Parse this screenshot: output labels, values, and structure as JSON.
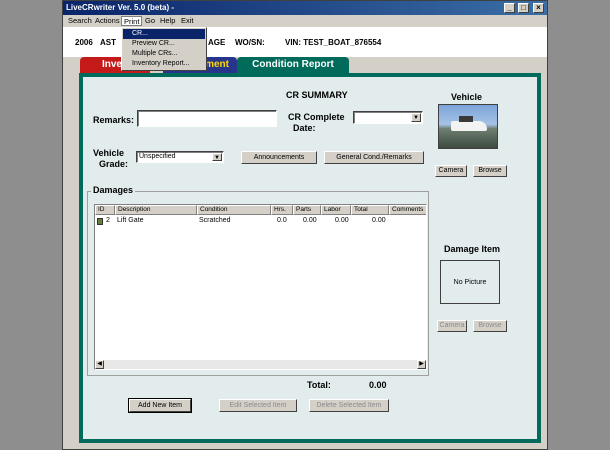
{
  "window": {
    "title": "LiveCRwriter Ver. 5.0 (beta) -"
  },
  "menu": {
    "items": [
      "Search",
      "Actions",
      "Print",
      "Go",
      "Help",
      "Exit"
    ]
  },
  "print_menu": {
    "items": [
      "CR...",
      "Preview CR...",
      "Multiple CRs...",
      "Inventory Report..."
    ]
  },
  "info": {
    "year": "2006",
    "make": "AST",
    "partial": "AGE",
    "wo_label": "WO/SN:",
    "vin": "VIN: TEST_BOAT_876554"
  },
  "tabs": {
    "inventory": "Inven",
    "equipment": "ment",
    "condition": "Condition Report"
  },
  "summary": {
    "title": "CR SUMMARY",
    "remarks_label": "Remarks:",
    "remarks_value": "",
    "complete_date_label_1": "CR Complete",
    "complete_date_label_2": "Date:",
    "grade_label_1": "Vehicle",
    "grade_label_2": "Grade:",
    "grade_value": "Unspecified",
    "announcements_btn": "Announcements",
    "general_btn": "General Cond./Remarks"
  },
  "vehicle": {
    "title": "Vehicle",
    "camera_btn": "Camera",
    "browse_btn": "Browse"
  },
  "damages": {
    "title": "Damages",
    "columns": [
      "ID",
      "Description",
      "Condition",
      "Hrs.",
      "Parts",
      "Labor",
      "Total",
      "Comments"
    ],
    "rows": [
      {
        "id": "2",
        "description": "Lift Gate",
        "condition": "Scratched",
        "hrs": "0.0",
        "parts": "0.00",
        "labor": "0.00",
        "total": "0.00",
        "comments": ""
      }
    ],
    "total_label": "Total:",
    "total_value": "0.00",
    "add_btn": "Add New Item",
    "edit_btn": "Edit Selected Item",
    "delete_btn": "Delete Selected Item"
  },
  "damage_item": {
    "title": "Damage Item",
    "no_picture": "No Picture",
    "camera_btn": "Camera",
    "browse_btn": "Browse"
  }
}
